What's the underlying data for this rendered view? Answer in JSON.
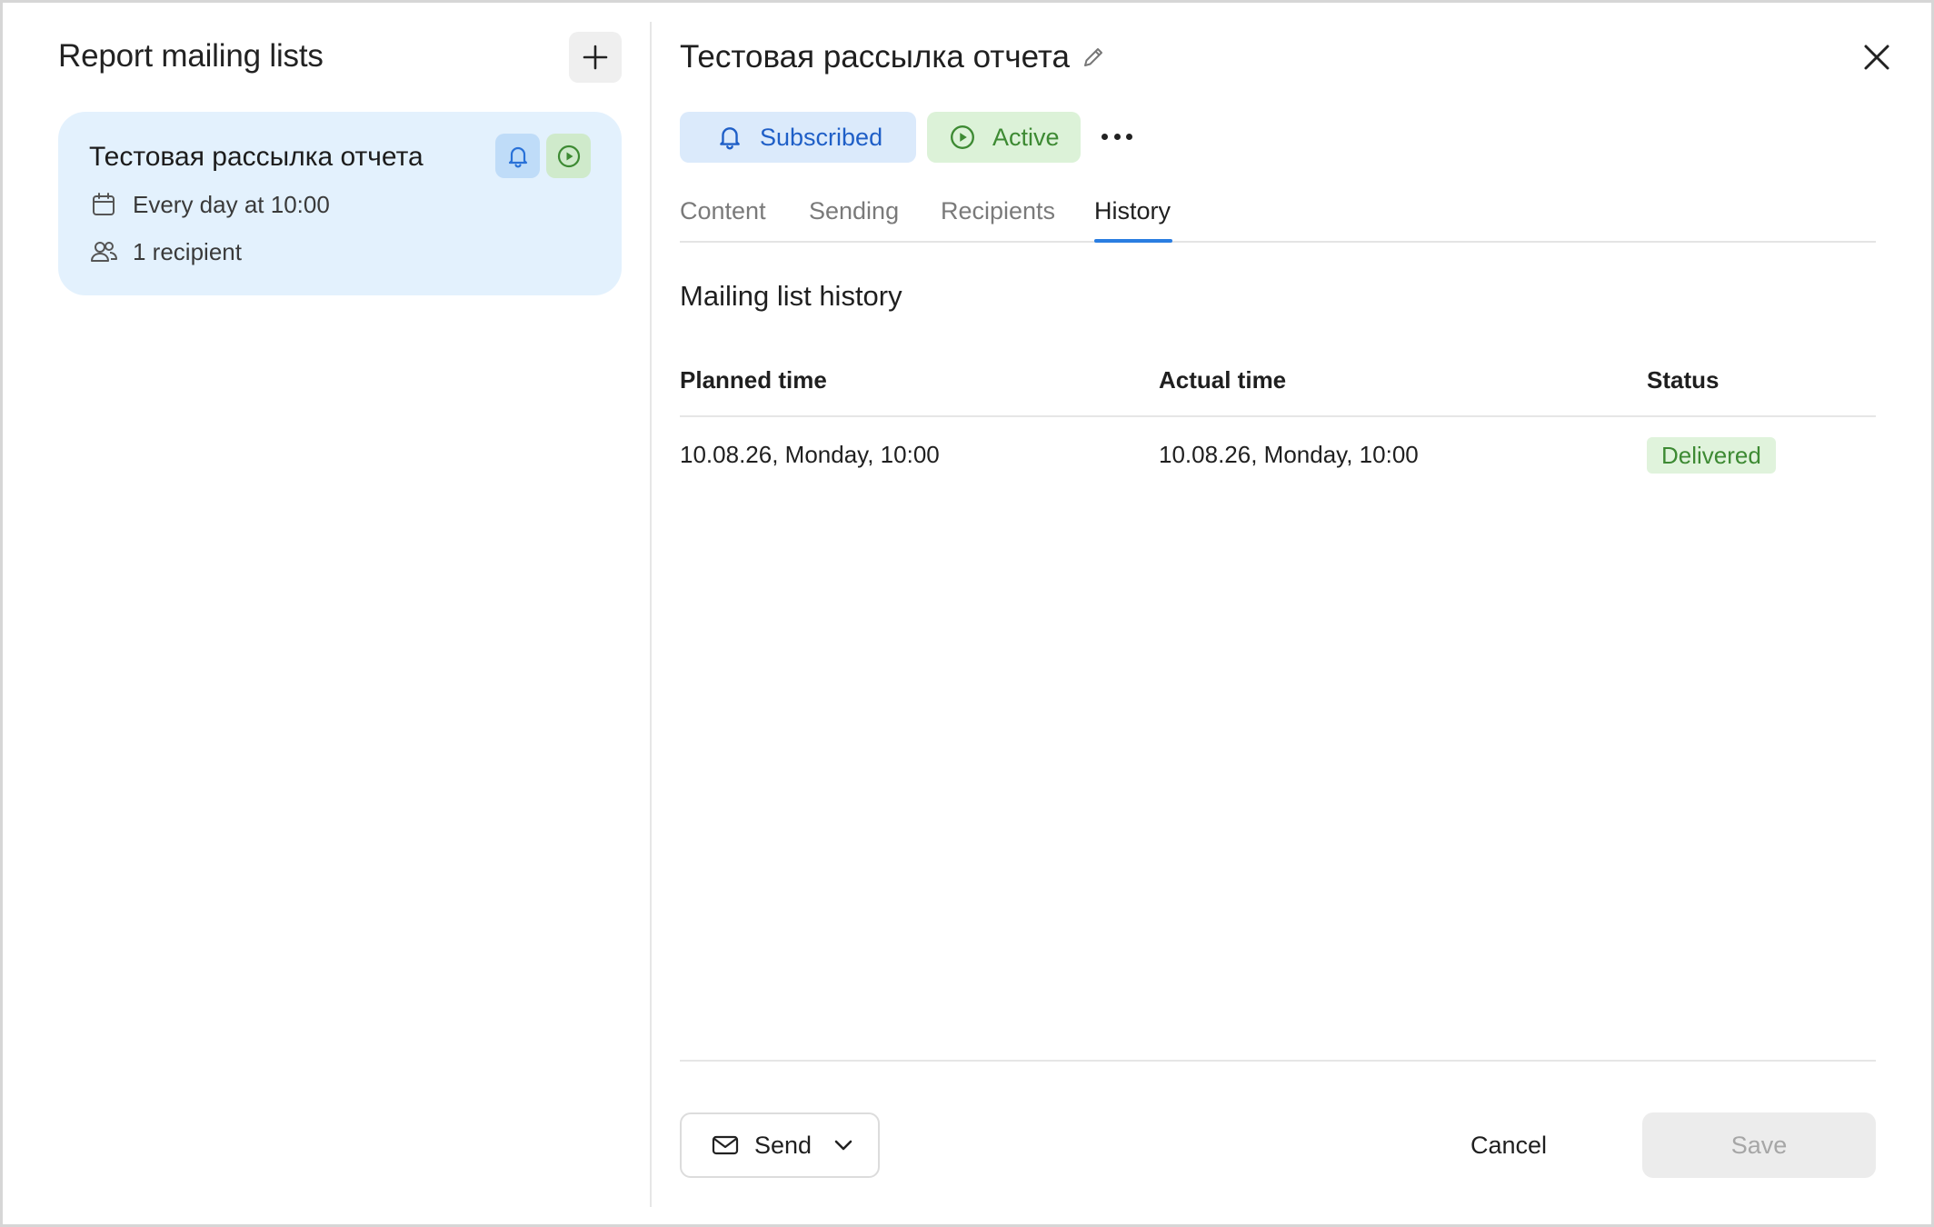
{
  "sidebar": {
    "title": "Report mailing lists",
    "mailing_lists": [
      {
        "name": "Тестовая рассылка отчета",
        "schedule": "Every day at 10:00",
        "recipients": "1 recipient"
      }
    ]
  },
  "header": {
    "title": "Тестовая рассылка отчета"
  },
  "status_chips": {
    "subscribed": "Subscribed",
    "active": "Active"
  },
  "tabs": [
    {
      "label": "Content",
      "active": false
    },
    {
      "label": "Sending",
      "active": false
    },
    {
      "label": "Recipients",
      "active": false
    },
    {
      "label": "History",
      "active": true
    }
  ],
  "history": {
    "title": "Mailing list history",
    "columns": [
      "Planned time",
      "Actual time",
      "Status"
    ],
    "rows": [
      {
        "planned": "10.08.26, Monday, 10:00",
        "actual": "10.08.26, Monday, 10:00",
        "status": "Delivered"
      }
    ]
  },
  "footer": {
    "send_label": "Send",
    "cancel_label": "Cancel",
    "save_label": "Save"
  },
  "colors": {
    "accent": "#2a7de1",
    "subscribed_bg": "#dbeafb",
    "active_bg": "#dcf2d8",
    "delivered_bg": "#e0f3dc",
    "card_bg": "#e3f1fd"
  },
  "icons": {
    "add": "plus-icon",
    "bell": "bell-icon",
    "play": "play-circle-icon",
    "calendar": "calendar-icon",
    "people": "people-icon",
    "edit": "pencil-icon",
    "close": "close-icon",
    "more": "more-horizontal-icon",
    "send": "envelope-icon",
    "dropdown": "chevron-down-icon"
  }
}
